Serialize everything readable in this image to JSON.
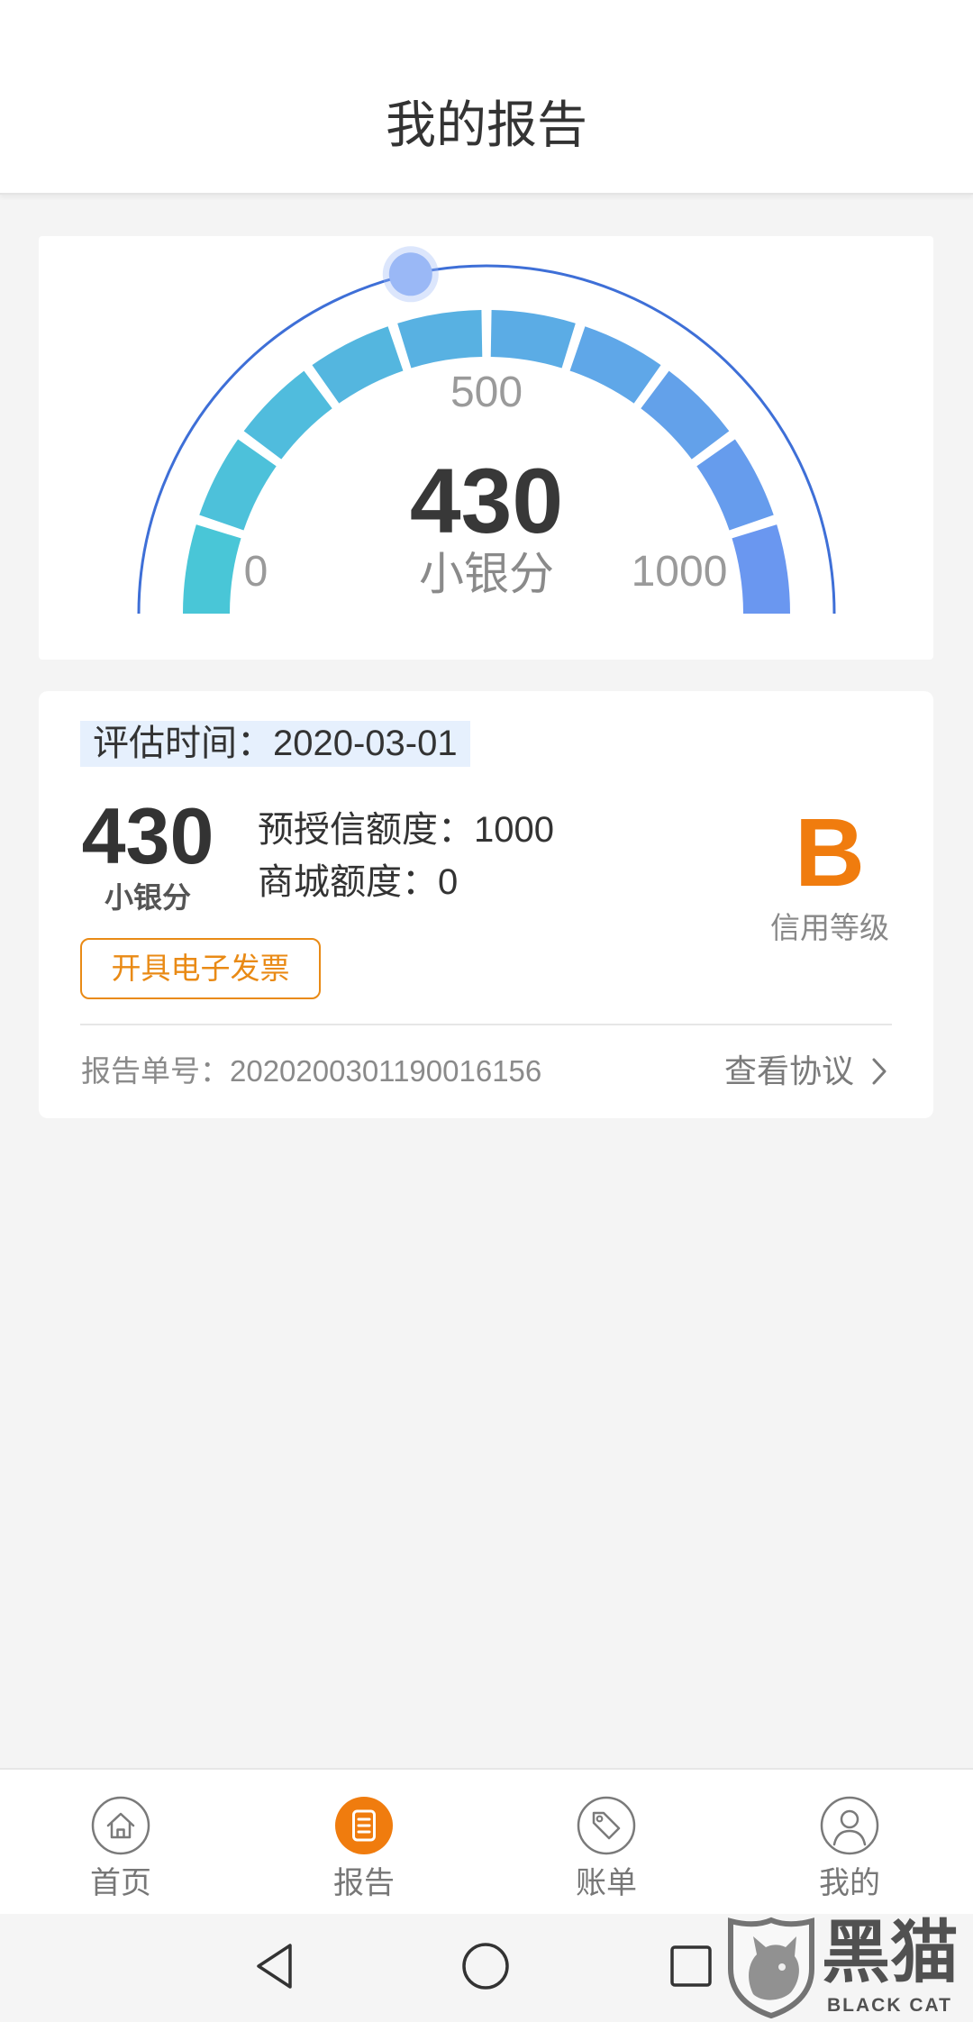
{
  "header": {
    "title": "我的报告"
  },
  "gauge": {
    "score": 430,
    "unit": "小银分",
    "scale": {
      "min": 0,
      "mid": 500,
      "max": 1000
    }
  },
  "summary": {
    "eval_time": {
      "label": "评估时间：",
      "value": "2020-03-01"
    },
    "score": "430",
    "unit": "小银分",
    "pre_credit": {
      "label": "预授信额度：",
      "value": "1000"
    },
    "mall_quota": {
      "label": "商城额度：",
      "value": "0"
    },
    "grade": {
      "value": "B",
      "label": "信用等级"
    },
    "invoice_button": "开具电子发票",
    "report_no": {
      "label": "报告单号：",
      "value": "2020200301190016156"
    },
    "agreement_link": "查看协议"
  },
  "bottom_nav": {
    "items": [
      {
        "label": "首页",
        "icon": "home-icon",
        "active": false
      },
      {
        "label": "报告",
        "icon": "report-icon",
        "active": true
      },
      {
        "label": "账单",
        "icon": "bill-tag-icon",
        "active": false
      },
      {
        "label": "我的",
        "icon": "profile-icon",
        "active": false
      }
    ]
  },
  "system_nav": {
    "buttons": [
      {
        "icon": "back-icon"
      },
      {
        "icon": "home-circle-icon"
      },
      {
        "icon": "recents-icon"
      }
    ]
  },
  "watermark": {
    "title": "黑猫",
    "subtitle": "BLACK CAT",
    "icon": "black-cat-logo-icon"
  },
  "colors": {
    "accent_orange": "#f07c0e",
    "button_orange": "#e98a15",
    "gauge_arc": "#3e6fd7",
    "gauge_start": "#49c6d7",
    "gauge_end": "#6a97f0",
    "knob": "#9ab8f6",
    "badge_bg": "#e6f0fd",
    "page_bg": "#f4f4f4"
  }
}
